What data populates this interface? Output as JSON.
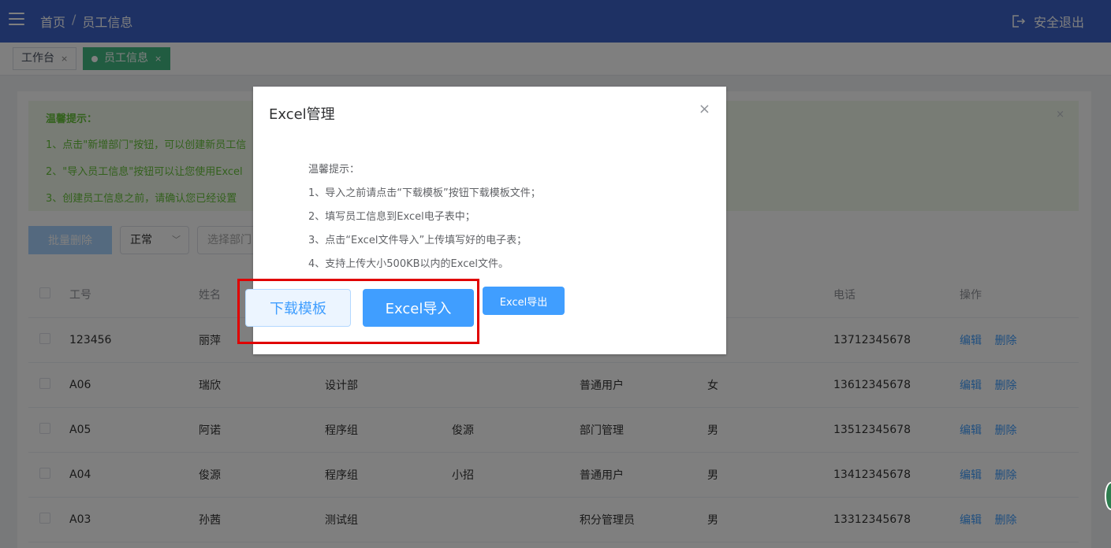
{
  "header": {
    "breadcrumb": [
      "首页",
      "/",
      "员工信息"
    ],
    "logout_label": "安全退出"
  },
  "tabs": [
    {
      "label": "工作台",
      "close": "×"
    },
    {
      "label": "员工信息",
      "close": "×"
    }
  ],
  "notice": {
    "title": "温馨提示：",
    "lines": [
      "1、点击\"新增部门\"按钮，可以创建新员工信",
      "2、\"导入员工信息\"按钮可以让您使用Excel",
      "3、创建员工信息之前，请确认您已经设置"
    ],
    "close": "×"
  },
  "toolbar": {
    "batch_delete": "批量删除",
    "status_select": "正常",
    "dept_select_placeholder": "选择部门"
  },
  "table": {
    "headers": [
      "工号",
      "姓名",
      "",
      "",
      "",
      "",
      "电话",
      "操作"
    ],
    "rows": [
      {
        "id": "123456",
        "name": "丽萍",
        "dept": "",
        "leader": "",
        "role": "",
        "gender": "",
        "phone": "13712345678"
      },
      {
        "id": "A06",
        "name": "瑞欣",
        "dept": "设计部",
        "leader": "",
        "role": "普通用户",
        "gender": "女",
        "phone": "13612345678"
      },
      {
        "id": "A05",
        "name": "阿诺",
        "dept": "程序组",
        "leader": "俊源",
        "role": "部门管理",
        "gender": "男",
        "phone": "13512345678"
      },
      {
        "id": "A04",
        "name": "俊源",
        "dept": "程序组",
        "leader": "小招",
        "role": "普通用户",
        "gender": "男",
        "phone": "13412345678"
      },
      {
        "id": "A03",
        "name": "孙茜",
        "dept": "测试组",
        "leader": "",
        "role": "积分管理员",
        "gender": "男",
        "phone": "13312345678"
      }
    ],
    "edit_label": "编辑",
    "delete_label": "删除"
  },
  "dialog": {
    "title": "Excel管理",
    "close": "×",
    "tips": [
      "温馨提示：",
      "1、导入之前请点击“下载模板”按钮下载模板文件；",
      "2、填写员工信息到Excel电子表中；",
      "3、点击“Excel文件导入”上传填写好的电子表；",
      "4、支持上传大小500KB以内的Excel文件。"
    ],
    "download_label": "下载模板",
    "import_label": "Excel导入",
    "export_label": "Excel导出"
  },
  "colors": {
    "header_bg": "#3c63c8",
    "tab_active": "#42b983",
    "primary": "#409eff",
    "highlight": "#e00000"
  }
}
